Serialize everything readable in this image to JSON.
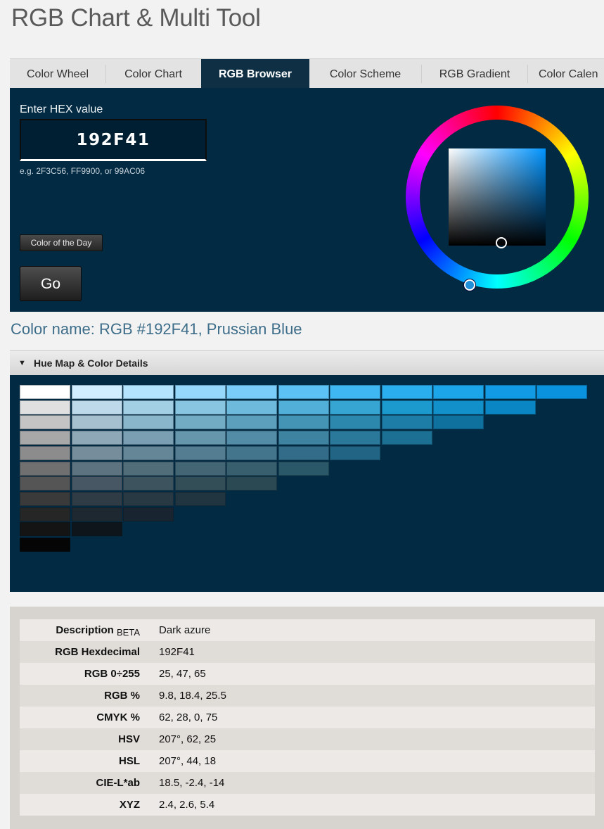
{
  "page": {
    "title": "RGB Chart & Multi Tool"
  },
  "tabs": [
    {
      "label": "Color Wheel",
      "active": false
    },
    {
      "label": "Color Chart",
      "active": false
    },
    {
      "label": "RGB Browser",
      "active": true
    },
    {
      "label": "Color Scheme",
      "active": false
    },
    {
      "label": "RGB Gradient",
      "active": false
    },
    {
      "label": "Color Calen",
      "active": false
    }
  ],
  "browser": {
    "hex_label": "Enter HEX value",
    "hex_value": "192F41",
    "hex_hint": "e.g. 2F3C56, FF9900, or 99AC06",
    "color_of_day_label": "Color of the Day",
    "go_label": "Go",
    "hue_degrees": 207,
    "saturation": 62,
    "value": 25,
    "accent_color": "#022a42"
  },
  "color_name": "Color name: RGB #192F41, Prussian Blue",
  "hue_map": {
    "header": "Hue Map & Color Details",
    "hue": 207,
    "columns": 11,
    "rows": 11,
    "palette": [
      [
        "#ffffff",
        "#d0eeff",
        "#b3e3fd",
        "#96d8fb",
        "#79cdf8",
        "#5cc2f5",
        "#3fb7f2",
        "#2aaeee",
        "#1da5ea",
        "#129be4",
        "#0a92de"
      ],
      [
        "#e0e0e0",
        "#bed9e9",
        "#a3cfe5",
        "#88c5e0",
        "#6dbadc",
        "#52afd7",
        "#37a5d2",
        "#1d9acd",
        "#1290c9",
        "#0a86c4",
        "#047cbf"
      ],
      [
        "#c4c4c4",
        "#a6c0d0",
        "#8ab6cb",
        "#72abc4",
        "#5b9fbd",
        "#4494b6",
        "#2d88ae",
        "#1e7da6",
        "#0e719e",
        "#056696",
        "#005a8e"
      ],
      [
        "#a8a8a8",
        "#8ea8b8",
        "#7a9fb2",
        "#6696ac",
        "#528ca6",
        "#3e83a0",
        "#2a799a",
        "#1c7094",
        "#0e668e",
        "#045c88",
        "#005282"
      ],
      [
        "#8c8c8c",
        "#768e9c",
        "#658697",
        "#547d92",
        "#43758d",
        "#326c88",
        "#216483",
        "#155c7e",
        "#095479",
        "#024c74",
        "#00446f"
      ],
      [
        "#707070",
        "#5e7380",
        "#516d7a",
        "#446674",
        "#375f6e",
        "#2a5868",
        "#1d5262",
        "#124b5c",
        "#084456",
        "#023d50",
        "#00364a"
      ],
      [
        "#555555",
        "#475864",
        "#3d535e",
        "#344e58",
        "#2a4952",
        "#21444c",
        "#183f46",
        "#103a40",
        "#08353a",
        "#023034",
        "#002b2e"
      ],
      [
        "#3a3a3a",
        "#2f3c46",
        "#283943",
        "#213540",
        "#1a323c",
        "#132f38",
        "#0c2b34",
        "#062830",
        "#02242c",
        "#002128",
        "#001d24"
      ],
      [
        "#262626",
        "#1d2830",
        "#182530",
        "#13222d",
        "#0e1f2a",
        "#0a1d28",
        "#061a25",
        "#031722",
        "#011520",
        "#00121d",
        "#00101b"
      ],
      [
        "#141414",
        "#0f161b",
        "#0c141a",
        "#091218",
        "#071016",
        "#050e14",
        "#030c12",
        "#020a10",
        "#01090e",
        "#00070c",
        "#00060a"
      ],
      [
        "#050505",
        "#03060a",
        "#02050a",
        "#020509",
        "#010408",
        "#010407",
        "#010306",
        "#000305",
        "#000204",
        "#000203",
        "#000102"
      ]
    ]
  },
  "details": {
    "rows": [
      {
        "label": "Description",
        "label_sub": "BETA",
        "value": "Dark azure"
      },
      {
        "label": "RGB Hexdecimal",
        "label_sub": "",
        "value": "192F41"
      },
      {
        "label": "RGB 0÷255",
        "label_sub": "",
        "value": "25, 47, 65"
      },
      {
        "label": "RGB %",
        "label_sub": "",
        "value": "9.8, 18.4, 25.5"
      },
      {
        "label": "CMYK %",
        "label_sub": "",
        "value": "62, 28, 0, 75"
      },
      {
        "label": "HSV",
        "label_sub": "",
        "value": "207°, 62, 25"
      },
      {
        "label": "HSL",
        "label_sub": "",
        "value": "207°, 44, 18"
      },
      {
        "label": "CIE-L*ab",
        "label_sub": "",
        "value": "18.5, -2.4, -14"
      },
      {
        "label": "XYZ",
        "label_sub": "",
        "value": "2.4, 2.6, 5.4"
      }
    ]
  }
}
